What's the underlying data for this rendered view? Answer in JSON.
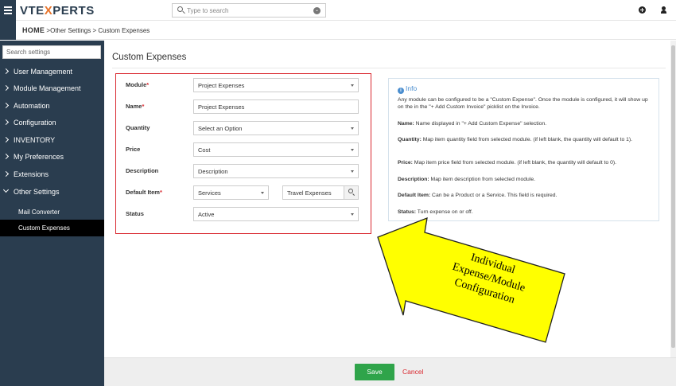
{
  "header": {
    "logo_prefix": "VTE",
    "logo_x": "X",
    "logo_suffix": "PERTS",
    "search_placeholder": "Type to search"
  },
  "breadcrumb": {
    "home": "HOME",
    "path": " >Other Settings >  Custom Expenses"
  },
  "sidebar": {
    "search_placeholder": "Search settings",
    "items": [
      {
        "label": "User Management"
      },
      {
        "label": "Module Management"
      },
      {
        "label": "Automation"
      },
      {
        "label": "Configuration"
      },
      {
        "label": "INVENTORY"
      },
      {
        "label": "My Preferences"
      },
      {
        "label": "Extensions"
      },
      {
        "label": "Other Settings"
      }
    ],
    "sub_items": [
      {
        "label": "Mail Converter"
      },
      {
        "label": "Custom Expenses"
      }
    ]
  },
  "main": {
    "title": "Custom Expenses",
    "form": {
      "module": {
        "label": "Module",
        "value": "Project Expenses"
      },
      "name": {
        "label": "Name",
        "value": "Project Expenses"
      },
      "quantity": {
        "label": "Quantity",
        "value": "Select an Option"
      },
      "price": {
        "label": "Price",
        "value": "Cost"
      },
      "description": {
        "label": "Description",
        "value": "Description"
      },
      "default_item": {
        "label": "Default Item",
        "type_value": "Services",
        "item_value": "Travel Expenses"
      },
      "status": {
        "label": "Status",
        "value": "Active"
      },
      "required_mark": "*"
    },
    "info": {
      "title": "Info",
      "intro": "Any module can be configured to be a \"Custom Expense\". Once the module is configured, it will show up on the in the \"+ Add Custom Invoice\" picklist on the Invoice.",
      "name_label": "Name:",
      "name_text": " Name displayed in \"+ Add Custom Expense\" selection.",
      "quantity_label": "Quantity:",
      "quantity_text": " Map item quantity field from selected module. (if left blank, the quantity will default to 1).",
      "price_label": "Price:",
      "price_text": " Map item price field from selected module. (if left blank, the quantity will default to 0).",
      "description_label": "Description:",
      "description_text": " Map item description from selected module.",
      "default_label": "Default Item:",
      "default_text": " Can be a Product or a Service. This field is required.",
      "status_label": "Status:",
      "status_text": " Turn expense on or off."
    },
    "annotation": {
      "line1": "Individual",
      "line2": "Expense/Module",
      "line3": "Configuration",
      "color": "#ffff00"
    }
  },
  "footer": {
    "save_label": "Save",
    "cancel_label": "Cancel"
  },
  "colors": {
    "sidebar_bg": "#2a3d4f",
    "required_red": "#d9282f",
    "save_green": "#2fa44a",
    "info_blue": "#4b8ecf"
  }
}
